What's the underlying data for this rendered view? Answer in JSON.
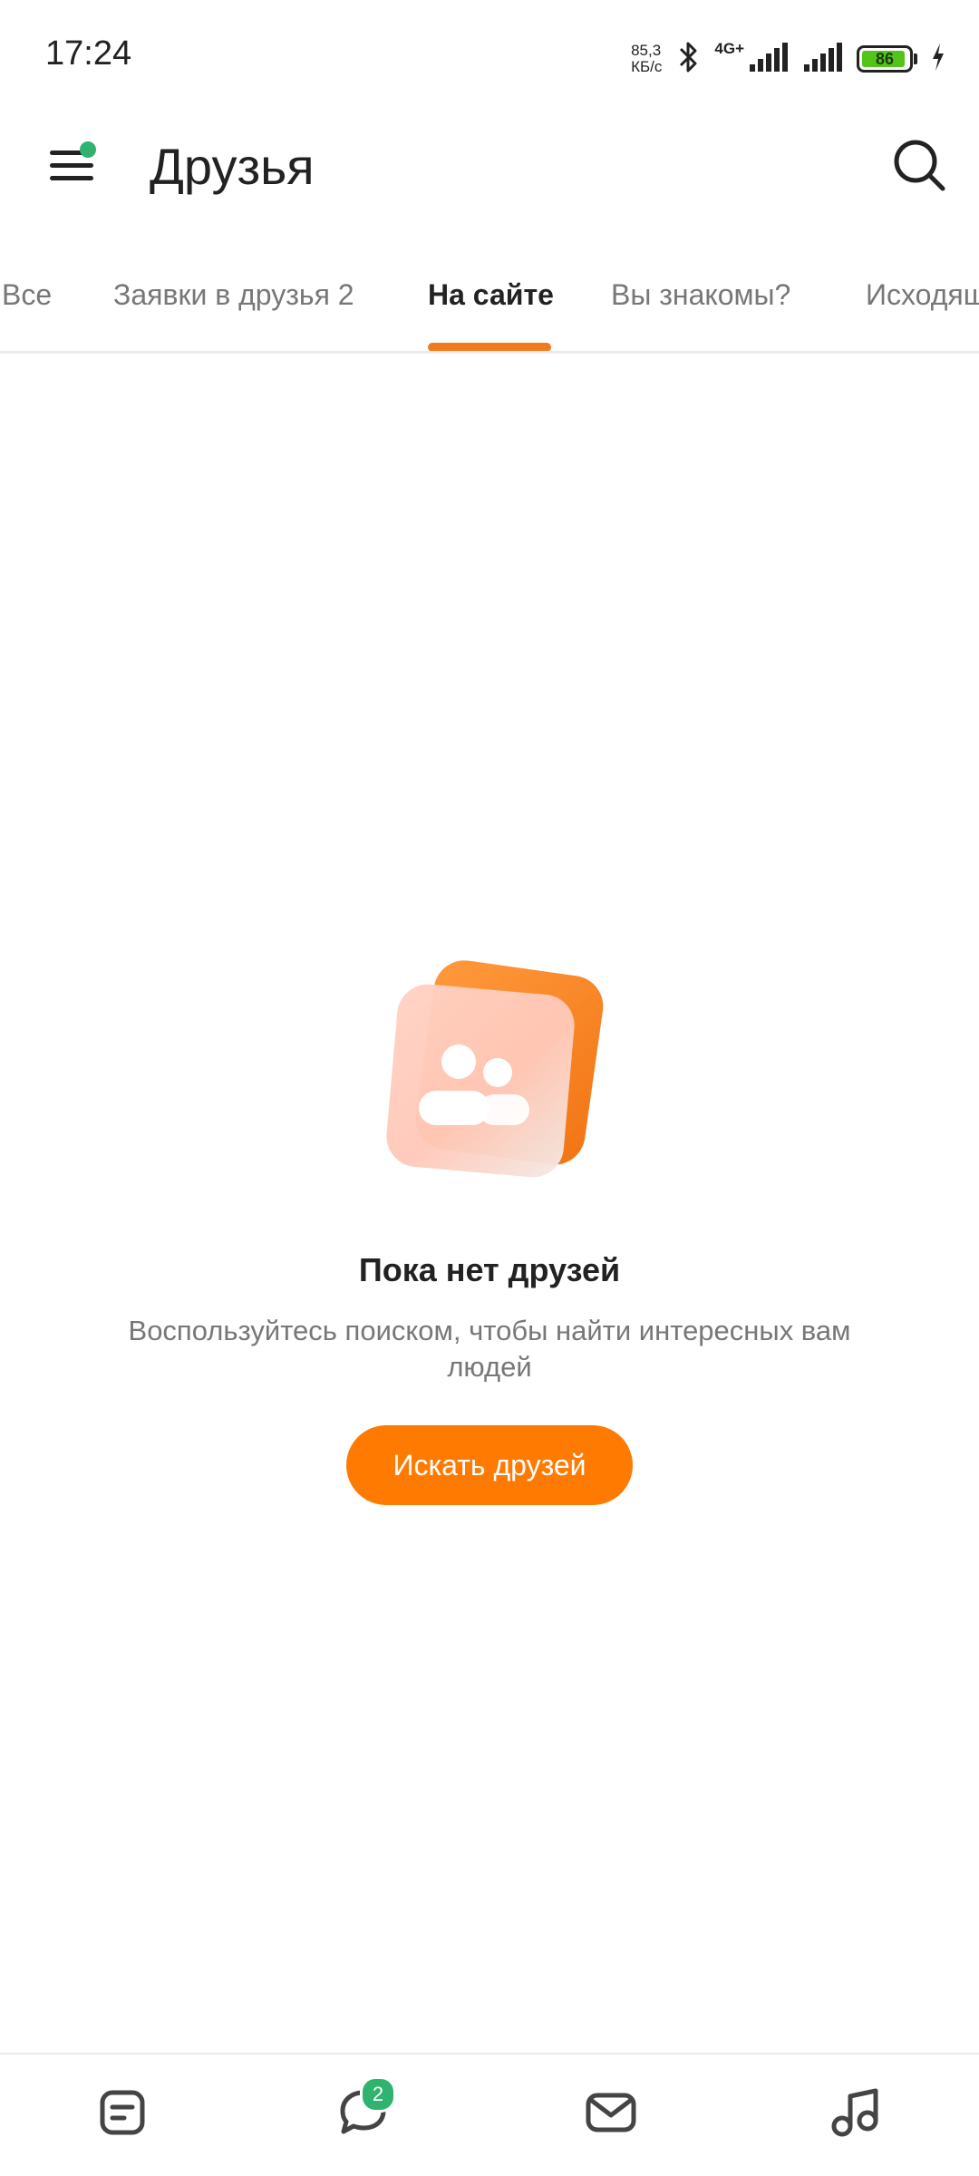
{
  "status_bar": {
    "time": "17:24",
    "net_speed_value": "85,3",
    "net_speed_unit": "КБ/с",
    "network_type": "4G+",
    "battery_level": "86",
    "icons": [
      "bluetooth-icon",
      "signal-icon",
      "signal-icon",
      "battery-icon",
      "charging-icon"
    ]
  },
  "header": {
    "title": "Друзья",
    "menu_icon": "menu-icon",
    "search_icon": "search-icon"
  },
  "tabs": [
    {
      "label": "Все",
      "active": false
    },
    {
      "label": "Заявки в друзья 2",
      "active": false
    },
    {
      "label": "На сайте",
      "active": true
    },
    {
      "label": "Вы знакомы?",
      "active": false
    },
    {
      "label": "Исходящ",
      "active": false
    }
  ],
  "empty_state": {
    "title": "Пока нет друзей",
    "description": "Воспользуйтесь поиском, чтобы найти интересных вам людей",
    "button_label": "Искать друзей",
    "illustration_icon": "friends-icon"
  },
  "bottom_nav": {
    "items": [
      {
        "icon": "feed-icon"
      },
      {
        "icon": "discussions-icon",
        "badge": "2"
      },
      {
        "icon": "messages-icon"
      },
      {
        "icon": "music-icon"
      }
    ]
  },
  "colors": {
    "accent": "#ff7a00",
    "tab_indicator": "#f07a1c",
    "badge": "#2fb36f",
    "battery": "#52c41a"
  }
}
